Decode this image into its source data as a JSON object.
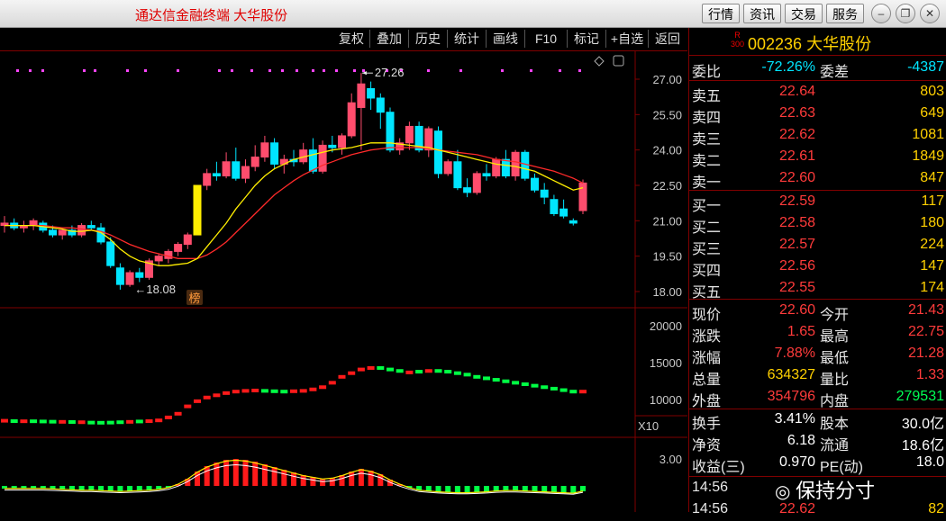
{
  "app": {
    "title": "通达信金融终端  大华股份"
  },
  "nav": {
    "buttons": [
      "行情",
      "资讯",
      "交易",
      "服务"
    ]
  },
  "toolbar": {
    "items": [
      "复权",
      "叠加",
      "历史",
      "统计",
      "画线",
      "F10",
      "标记",
      "+自选",
      "返回"
    ]
  },
  "stock": {
    "badge_r": "R",
    "badge_n": "300",
    "code_name": "002236 大华股份"
  },
  "orderbook": {
    "ratio_label": "委比",
    "ratio": "-72.26%",
    "diff_label": "委差",
    "diff": "-4387",
    "asks": [
      {
        "label": "卖五",
        "price": "22.64",
        "vol": "803"
      },
      {
        "label": "卖四",
        "price": "22.63",
        "vol": "649"
      },
      {
        "label": "卖三",
        "price": "22.62",
        "vol": "1081"
      },
      {
        "label": "卖二",
        "price": "22.61",
        "vol": "1849"
      },
      {
        "label": "卖一",
        "price": "22.60",
        "vol": "847"
      }
    ],
    "bids": [
      {
        "label": "买一",
        "price": "22.59",
        "vol": "117"
      },
      {
        "label": "买二",
        "price": "22.58",
        "vol": "180"
      },
      {
        "label": "买三",
        "price": "22.57",
        "vol": "224"
      },
      {
        "label": "买四",
        "price": "22.56",
        "vol": "147"
      },
      {
        "label": "买五",
        "price": "22.55",
        "vol": "174"
      }
    ]
  },
  "stats": [
    {
      "l1": "现价",
      "v1": "22.60",
      "c1": "red",
      "l2": "今开",
      "v2": "21.43",
      "c2": "red"
    },
    {
      "l1": "涨跌",
      "v1": "1.65",
      "c1": "red",
      "l2": "最高",
      "v2": "22.75",
      "c2": "red"
    },
    {
      "l1": "涨幅",
      "v1": "7.88%",
      "c1": "red",
      "l2": "最低",
      "v2": "21.28",
      "c2": "red"
    },
    {
      "l1": "总量",
      "v1": "634327",
      "c1": "yel",
      "l2": "量比",
      "v2": "1.33",
      "c2": "red"
    },
    {
      "l1": "外盘",
      "v1": "354796",
      "c1": "red",
      "l2": "内盘",
      "v2": "279531",
      "c2": "grn"
    }
  ],
  "stats2": [
    {
      "l1": "换手",
      "v1": "3.41%",
      "l2": "股本",
      "v2": "30.0亿"
    },
    {
      "l1": "净资",
      "v1": "6.18",
      "l2": "流通",
      "v2": "18.6亿"
    },
    {
      "l1": "收益(三)",
      "v1": "0.970",
      "l2": "PE(动)",
      "v2": "18.0"
    }
  ],
  "ticks": [
    {
      "time": "14:56",
      "price": "",
      "vol": ""
    },
    {
      "time": "14:56",
      "price": "22.62",
      "vol": "82"
    }
  ],
  "watermark": "保持分寸",
  "chart_data": {
    "type": "candlestick",
    "yaxis_ticks": [
      "27.00",
      "25.50",
      "24.00",
      "22.50",
      "21.00",
      "19.50",
      "18.00"
    ],
    "high_label": "27.26",
    "low_label": "18.08",
    "badge_label": "榜",
    "volume_axis_ticks": [
      "20000",
      "15000",
      "10000"
    ],
    "volume_unit": "X10",
    "macd_tick": "3.00",
    "macd_tick_partial": "-",
    "colors": {
      "up": "#ff4d6d",
      "down": "#00e5ff",
      "ma5": "#ffee00",
      "ma10": "#ff2a2a",
      "limit": "#ffee00"
    },
    "candles": [
      {
        "o": 20.8,
        "h": 21.2,
        "l": 20.5,
        "c": 20.9
      },
      {
        "o": 20.9,
        "h": 21.1,
        "l": 20.6,
        "c": 20.7
      },
      {
        "o": 20.7,
        "h": 21.0,
        "l": 20.5,
        "c": 20.8
      },
      {
        "o": 20.8,
        "h": 21.1,
        "l": 20.6,
        "c": 21.0
      },
      {
        "o": 20.9,
        "h": 21.0,
        "l": 20.5,
        "c": 20.6
      },
      {
        "o": 20.6,
        "h": 20.8,
        "l": 20.3,
        "c": 20.4
      },
      {
        "o": 20.4,
        "h": 20.7,
        "l": 20.2,
        "c": 20.6
      },
      {
        "o": 20.6,
        "h": 20.8,
        "l": 20.3,
        "c": 20.4
      },
      {
        "o": 20.4,
        "h": 20.9,
        "l": 20.3,
        "c": 20.8
      },
      {
        "o": 20.8,
        "h": 21.0,
        "l": 20.6,
        "c": 20.7
      },
      {
        "o": 20.7,
        "h": 20.9,
        "l": 20.0,
        "c": 20.1
      },
      {
        "o": 20.1,
        "h": 20.3,
        "l": 19.0,
        "c": 19.1
      },
      {
        "o": 19.0,
        "h": 19.2,
        "l": 18.08,
        "c": 18.3
      },
      {
        "o": 18.3,
        "h": 18.9,
        "l": 18.2,
        "c": 18.8
      },
      {
        "o": 18.8,
        "h": 19.0,
        "l": 18.4,
        "c": 18.6
      },
      {
        "o": 18.6,
        "h": 19.4,
        "l": 18.5,
        "c": 19.3
      },
      {
        "o": 19.3,
        "h": 19.6,
        "l": 19.1,
        "c": 19.5
      },
      {
        "o": 19.4,
        "h": 19.8,
        "l": 19.2,
        "c": 19.7
      },
      {
        "o": 19.7,
        "h": 20.1,
        "l": 19.5,
        "c": 20.0
      },
      {
        "o": 20.0,
        "h": 20.5,
        "l": 19.8,
        "c": 20.4
      },
      {
        "o": 20.4,
        "h": 22.5,
        "l": 20.4,
        "c": 22.5
      },
      {
        "o": 22.5,
        "h": 23.2,
        "l": 22.3,
        "c": 23.0
      },
      {
        "o": 23.0,
        "h": 23.5,
        "l": 22.7,
        "c": 22.9
      },
      {
        "o": 22.9,
        "h": 23.9,
        "l": 22.8,
        "c": 23.5
      },
      {
        "o": 23.5,
        "h": 24.1,
        "l": 22.7,
        "c": 22.8
      },
      {
        "o": 22.8,
        "h": 23.6,
        "l": 22.6,
        "c": 23.3
      },
      {
        "o": 23.3,
        "h": 24.2,
        "l": 23.1,
        "c": 23.7
      },
      {
        "o": 23.7,
        "h": 24.6,
        "l": 23.5,
        "c": 24.3
      },
      {
        "o": 24.3,
        "h": 24.5,
        "l": 23.2,
        "c": 23.4
      },
      {
        "o": 23.4,
        "h": 23.8,
        "l": 23.0,
        "c": 23.6
      },
      {
        "o": 23.6,
        "h": 24.0,
        "l": 23.3,
        "c": 23.5
      },
      {
        "o": 23.5,
        "h": 24.3,
        "l": 23.4,
        "c": 24.0
      },
      {
        "o": 24.0,
        "h": 24.5,
        "l": 23.0,
        "c": 23.1
      },
      {
        "o": 23.1,
        "h": 24.4,
        "l": 23.0,
        "c": 24.2
      },
      {
        "o": 24.2,
        "h": 24.6,
        "l": 23.9,
        "c": 24.1
      },
      {
        "o": 24.1,
        "h": 24.7,
        "l": 23.8,
        "c": 24.6
      },
      {
        "o": 24.6,
        "h": 26.4,
        "l": 24.5,
        "c": 26.0
      },
      {
        "o": 25.8,
        "h": 27.26,
        "l": 24.0,
        "c": 26.8
      },
      {
        "o": 26.6,
        "h": 26.9,
        "l": 25.7,
        "c": 26.2
      },
      {
        "o": 26.2,
        "h": 26.4,
        "l": 24.9,
        "c": 25.6
      },
      {
        "o": 25.6,
        "h": 25.8,
        "l": 23.9,
        "c": 24.0
      },
      {
        "o": 24.0,
        "h": 24.5,
        "l": 23.8,
        "c": 24.3
      },
      {
        "o": 24.3,
        "h": 25.2,
        "l": 24.0,
        "c": 25.0
      },
      {
        "o": 25.0,
        "h": 25.2,
        "l": 23.9,
        "c": 24.0
      },
      {
        "o": 24.0,
        "h": 25.0,
        "l": 23.7,
        "c": 24.9
      },
      {
        "o": 24.8,
        "h": 25.0,
        "l": 22.8,
        "c": 23.0
      },
      {
        "o": 23.0,
        "h": 23.6,
        "l": 22.9,
        "c": 23.5
      },
      {
        "o": 23.5,
        "h": 24.0,
        "l": 22.3,
        "c": 22.4
      },
      {
        "o": 22.4,
        "h": 22.8,
        "l": 22.0,
        "c": 22.2
      },
      {
        "o": 22.2,
        "h": 23.1,
        "l": 22.1,
        "c": 23.0
      },
      {
        "o": 23.0,
        "h": 23.4,
        "l": 22.7,
        "c": 22.9
      },
      {
        "o": 22.9,
        "h": 23.7,
        "l": 22.8,
        "c": 23.6
      },
      {
        "o": 23.6,
        "h": 24.0,
        "l": 22.8,
        "c": 22.9
      },
      {
        "o": 22.9,
        "h": 24.0,
        "l": 22.7,
        "c": 23.9
      },
      {
        "o": 23.9,
        "h": 24.0,
        "l": 22.7,
        "c": 22.8
      },
      {
        "o": 22.8,
        "h": 23.0,
        "l": 22.2,
        "c": 22.3
      },
      {
        "o": 22.3,
        "h": 22.6,
        "l": 21.7,
        "c": 22.0
      },
      {
        "o": 21.9,
        "h": 22.1,
        "l": 21.2,
        "c": 21.3
      },
      {
        "o": 21.5,
        "h": 21.9,
        "l": 21.1,
        "c": 21.2
      },
      {
        "o": 21.0,
        "h": 21.1,
        "l": 20.8,
        "c": 20.9
      },
      {
        "o": 21.43,
        "h": 22.75,
        "l": 21.28,
        "c": 22.6
      }
    ],
    "ma5": [
      20.8,
      20.8,
      20.8,
      20.8,
      20.75,
      20.7,
      20.65,
      20.55,
      20.55,
      20.6,
      20.5,
      20.2,
      19.8,
      19.5,
      19.3,
      19.2,
      19.1,
      19.1,
      19.15,
      19.2,
      19.4,
      19.9,
      20.4,
      20.9,
      21.5,
      22.0,
      22.5,
      22.9,
      23.2,
      23.4,
      23.6,
      23.7,
      23.8,
      23.9,
      24.0,
      24.05,
      24.1,
      24.2,
      24.3,
      24.3,
      24.3,
      24.25,
      24.2,
      24.15,
      24.1,
      24.0,
      23.9,
      23.8,
      23.7,
      23.6,
      23.5,
      23.4,
      23.35,
      23.3,
      23.2,
      23.1,
      22.9,
      22.7,
      22.5,
      22.3,
      22.4
    ],
    "ma10": [
      20.8,
      20.8,
      20.8,
      20.8,
      20.8,
      20.75,
      20.7,
      20.7,
      20.65,
      20.6,
      20.55,
      20.4,
      20.2,
      20.0,
      19.85,
      19.7,
      19.6,
      19.5,
      19.4,
      19.4,
      19.4,
      19.55,
      19.8,
      20.1,
      20.5,
      20.9,
      21.3,
      21.7,
      22.1,
      22.4,
      22.7,
      22.95,
      23.15,
      23.35,
      23.5,
      23.65,
      23.8,
      23.9,
      24.0,
      24.05,
      24.1,
      24.1,
      24.1,
      24.1,
      24.05,
      24.0,
      23.95,
      23.9,
      23.85,
      23.8,
      23.7,
      23.6,
      23.55,
      23.5,
      23.4,
      23.3,
      23.2,
      23.1,
      22.95,
      22.8,
      22.6
    ],
    "volume_values": [
      1005,
      1000,
      998,
      998,
      995,
      992,
      990,
      988,
      985,
      980,
      978,
      980,
      985,
      990,
      995,
      1000,
      1010,
      1050,
      1100,
      1200,
      1270,
      1320,
      1350,
      1380,
      1400,
      1410,
      1415,
      1410,
      1405,
      1400,
      1405,
      1410,
      1430,
      1460,
      1520,
      1600,
      1650,
      1700,
      1720,
      1720,
      1700,
      1680,
      1660,
      1670,
      1680,
      1680,
      1670,
      1650,
      1630,
      1600,
      1580,
      1560,
      1540,
      1520,
      1500,
      1480,
      1460,
      1440,
      1420,
      1400,
      1400
    ],
    "volume_series_up": [
      true,
      false,
      true,
      false,
      false,
      false,
      true,
      false,
      true,
      false,
      false,
      false,
      false,
      true,
      false,
      true,
      true,
      true,
      true,
      true,
      true,
      true,
      true,
      true,
      true,
      true,
      true,
      false,
      false,
      false,
      true,
      true,
      true,
      true,
      true,
      true,
      true,
      true,
      true,
      false,
      false,
      false,
      true,
      false,
      true,
      false,
      false,
      false,
      false,
      false,
      false,
      false,
      false,
      false,
      false,
      false,
      false,
      false,
      false,
      false,
      true
    ],
    "macd_values": [
      -0.3,
      -0.3,
      -0.3,
      -0.3,
      -0.3,
      -0.35,
      -0.4,
      -0.45,
      -0.5,
      -0.5,
      -0.55,
      -0.6,
      -0.65,
      -0.6,
      -0.55,
      -0.5,
      -0.4,
      -0.2,
      0.2,
      0.8,
      1.6,
      2.2,
      2.6,
      2.9,
      3.0,
      2.9,
      2.7,
      2.4,
      2.1,
      1.8,
      1.5,
      1.2,
      1.0,
      0.8,
      0.9,
      1.2,
      1.6,
      1.9,
      1.7,
      1.3,
      0.7,
      0.2,
      -0.2,
      -0.5,
      -0.6,
      -0.7,
      -0.75,
      -0.8,
      -0.8,
      -0.75,
      -0.7,
      -0.6,
      -0.55,
      -0.55,
      -0.6,
      -0.65,
      -0.7,
      -0.75,
      -0.8,
      -0.85,
      -0.6
    ]
  }
}
